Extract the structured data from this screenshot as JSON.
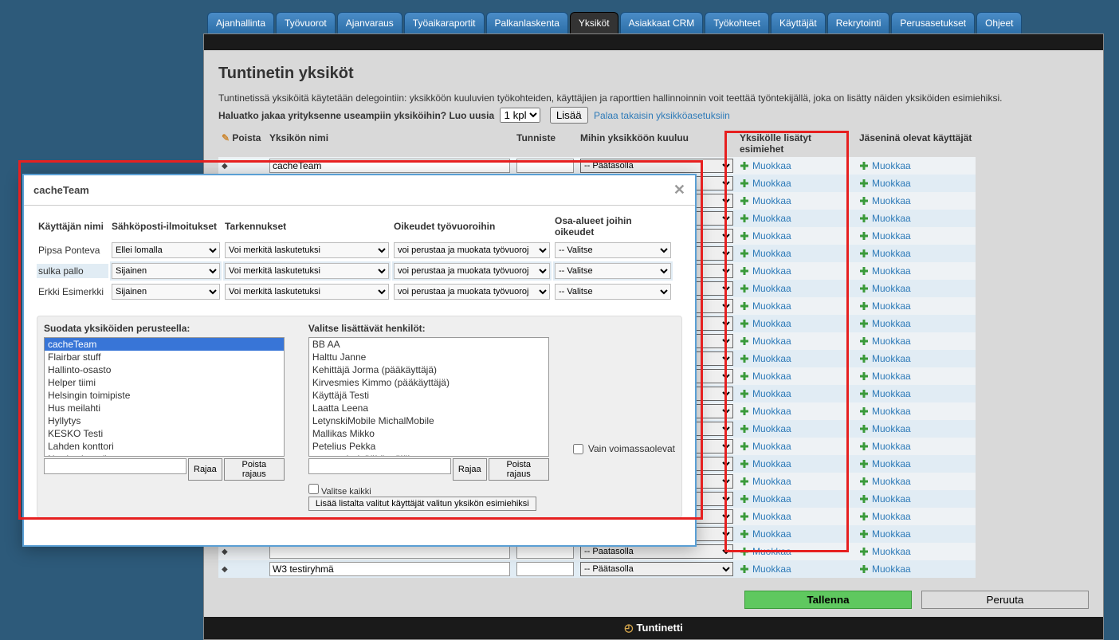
{
  "tabs": [
    "Ajanhallinta",
    "Työvuorot",
    "Ajanvaraus",
    "Työaikaraportit",
    "Palkanlaskenta",
    "Yksiköt",
    "Asiakkaat CRM",
    "Työkohteet",
    "Käyttäjät",
    "Rekrytointi",
    "Perusasetukset",
    "Ohjeet"
  ],
  "active_tab": "Yksiköt",
  "page_title": "Tuntinetin yksiköt",
  "intro": "Tuntinetissä yksiköitä käytetään delegointiin: yksikköön kuuluvien työkohteiden, käyttäjien ja raporttien hallinnoinnin voit teettää työntekijällä, joka on lisätty näiden yksiköiden esimiehiksi.",
  "question_bold": "Haluatko jakaa yrityksenne useampiin yksiköihin? Luo uusia",
  "qty_selected": "1 kpl",
  "add_button": "Lisää",
  "back_link": "Palaa takaisin yksikköasetuksiin",
  "headers": {
    "poista": "Poista",
    "nimi": "Yksikön nimi",
    "tunniste": "Tunniste",
    "mihin": "Mihin yksikköön kuuluu",
    "esimiehet": "Yksikölle lisätyt esimiehet",
    "jasenet": "Jäseninä olevat käyttäjät"
  },
  "first_unit": "cacheTeam",
  "parent": "-- Päätasolla",
  "edit_label": "Muokkaa",
  "last_unit_name": "W3 testiryhmä",
  "last_unit_parent": "-- Päätasolla",
  "visible_parent_row": "-- Paatasolla",
  "row_count": 24,
  "save": "Tallenna",
  "cancel": "Peruuta",
  "footer_text": "Tuntinetti",
  "modal": {
    "title": "cacheTeam",
    "cols": {
      "user": "Käyttäjän nimi",
      "email": "Sähköposti-ilmoitukset",
      "tark": "Tarkennukset",
      "rights": "Oikeudet työvuoroihin",
      "areas": "Osa-alueet joihin oikeudet"
    },
    "rows": [
      {
        "user": "Pipsa Ponteva",
        "email": "Ellei lomalla",
        "tark": "Voi merkitä laskutetuksi",
        "rights": "voi perustaa ja muokata työvuoroj",
        "area": "-- Valitse"
      },
      {
        "user": "sulka pallo",
        "email": "Sijainen",
        "tark": "Voi merkitä laskutetuksi",
        "rights": "voi perustaa ja muokata työvuoroj",
        "area": "-- Valitse"
      },
      {
        "user": "Erkki Esimerkki",
        "email": "Sijainen",
        "tark": "Voi merkitä laskutetuksi",
        "rights": "voi perustaa ja muokata työvuoroj",
        "area": "-- Valitse"
      }
    ],
    "filter_title1": "Suodata yksiköiden perusteella:",
    "filter_title2": "Valitse lisättävät henkilöt:",
    "units": [
      "cacheTeam",
      "Flairbar stuff",
      "Hallinto-osasto",
      "Helper tiimi",
      "Helsingin toimipiste",
      "Hus meilahti",
      "Hyllytys",
      "KESKO Testi",
      "Lahden konttori",
      "Nordex kenttä"
    ],
    "people": [
      "BB AA",
      "Halttu Janne",
      "Kehittäjä Jorma (pääkäyttäjä)",
      "Kirvesmies Kimmo (pääkäyttäjä)",
      "Käyttäjä Testi",
      "Laatta Leena",
      "LetynskiMobile MichalMobile",
      "Mallikas Mikko",
      "Petelius Pekka",
      "ss aramis (pääkäyttäjä)"
    ],
    "btn_rajaa": "Rajaa",
    "btn_poista": "Poista rajaus",
    "only_active": "Vain voimassaolevat",
    "select_all": "Valitse kaikki",
    "add_managers": "Lisää listalta valitut käyttäjät valitun yksikön esimiehiksi"
  }
}
